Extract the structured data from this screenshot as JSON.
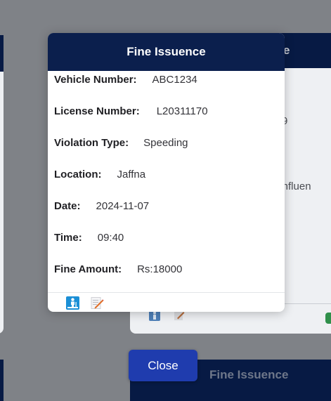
{
  "background": {
    "right_card": {
      "header_fragment": "e",
      "line1": "9",
      "line2": "er Influen"
    },
    "bottom_card_title": "Fine Issuence"
  },
  "modal": {
    "title": "Fine Issuence",
    "fields": [
      {
        "label": "Vehicle Number:",
        "value": "ABC1234"
      },
      {
        "label": "License Number:",
        "value": "L20311170"
      },
      {
        "label": "Violation Type:",
        "value": "Speeding"
      },
      {
        "label": "Location:",
        "value": "Jaffna"
      },
      {
        "label": "Date:",
        "value": "2024-11-07"
      },
      {
        "label": "Time:",
        "value": "09:40"
      },
      {
        "label": "Fine Amount:",
        "value": "Rs:18000"
      }
    ],
    "footer_icons": [
      "person-icon",
      "edit-icon"
    ]
  },
  "close_button": {
    "label": "Close"
  },
  "colors": {
    "header_navy": "#0b1f4d",
    "button_blue": "#1f3cae",
    "backdrop": "#7f8287"
  }
}
